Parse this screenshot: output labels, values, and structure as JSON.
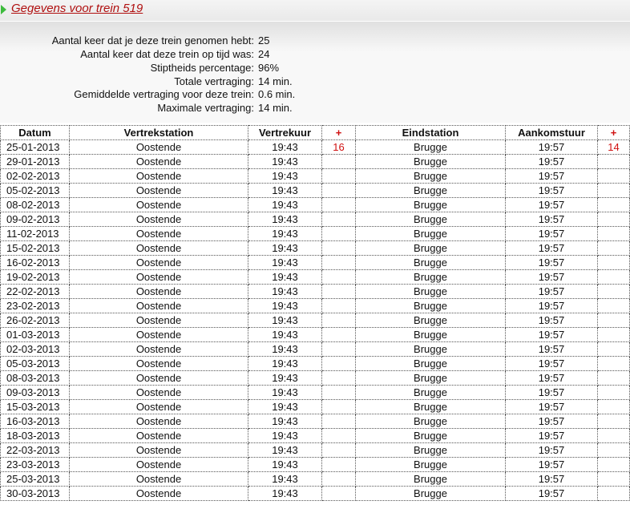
{
  "header": {
    "title": "Gegevens voor trein 519"
  },
  "summary": [
    {
      "label": "Aantal keer dat je deze trein genomen hebt:",
      "value": "25"
    },
    {
      "label": "Aantal keer dat deze trein op tijd was:",
      "value": "24"
    },
    {
      "label": "Stiptheids percentage:",
      "value": "96%"
    },
    {
      "label": "Totale vertraging:",
      "value": "14 min."
    },
    {
      "label": "Gemiddelde vertraging voor deze trein:",
      "value": "0.6 min."
    },
    {
      "label": "Maximale vertraging:",
      "value": "14 min."
    }
  ],
  "table": {
    "columns": [
      "Datum",
      "Vertrekstation",
      "Vertrekuur",
      "+",
      "Eindstation",
      "Aankomstuur",
      "+"
    ],
    "rows": [
      {
        "date": "25-01-2013",
        "from": "Oostende",
        "dep": "19:43",
        "dep_delay": "16",
        "to": "Brugge",
        "arr": "19:57",
        "arr_delay": "14"
      },
      {
        "date": "29-01-2013",
        "from": "Oostende",
        "dep": "19:43",
        "dep_delay": "",
        "to": "Brugge",
        "arr": "19:57",
        "arr_delay": ""
      },
      {
        "date": "02-02-2013",
        "from": "Oostende",
        "dep": "19:43",
        "dep_delay": "",
        "to": "Brugge",
        "arr": "19:57",
        "arr_delay": ""
      },
      {
        "date": "05-02-2013",
        "from": "Oostende",
        "dep": "19:43",
        "dep_delay": "",
        "to": "Brugge",
        "arr": "19:57",
        "arr_delay": ""
      },
      {
        "date": "08-02-2013",
        "from": "Oostende",
        "dep": "19:43",
        "dep_delay": "",
        "to": "Brugge",
        "arr": "19:57",
        "arr_delay": ""
      },
      {
        "date": "09-02-2013",
        "from": "Oostende",
        "dep": "19:43",
        "dep_delay": "",
        "to": "Brugge",
        "arr": "19:57",
        "arr_delay": ""
      },
      {
        "date": "11-02-2013",
        "from": "Oostende",
        "dep": "19:43",
        "dep_delay": "",
        "to": "Brugge",
        "arr": "19:57",
        "arr_delay": ""
      },
      {
        "date": "15-02-2013",
        "from": "Oostende",
        "dep": "19:43",
        "dep_delay": "",
        "to": "Brugge",
        "arr": "19:57",
        "arr_delay": ""
      },
      {
        "date": "16-02-2013",
        "from": "Oostende",
        "dep": "19:43",
        "dep_delay": "",
        "to": "Brugge",
        "arr": "19:57",
        "arr_delay": ""
      },
      {
        "date": "19-02-2013",
        "from": "Oostende",
        "dep": "19:43",
        "dep_delay": "",
        "to": "Brugge",
        "arr": "19:57",
        "arr_delay": ""
      },
      {
        "date": "22-02-2013",
        "from": "Oostende",
        "dep": "19:43",
        "dep_delay": "",
        "to": "Brugge",
        "arr": "19:57",
        "arr_delay": ""
      },
      {
        "date": "23-02-2013",
        "from": "Oostende",
        "dep": "19:43",
        "dep_delay": "",
        "to": "Brugge",
        "arr": "19:57",
        "arr_delay": ""
      },
      {
        "date": "26-02-2013",
        "from": "Oostende",
        "dep": "19:43",
        "dep_delay": "",
        "to": "Brugge",
        "arr": "19:57",
        "arr_delay": ""
      },
      {
        "date": "01-03-2013",
        "from": "Oostende",
        "dep": "19:43",
        "dep_delay": "",
        "to": "Brugge",
        "arr": "19:57",
        "arr_delay": ""
      },
      {
        "date": "02-03-2013",
        "from": "Oostende",
        "dep": "19:43",
        "dep_delay": "",
        "to": "Brugge",
        "arr": "19:57",
        "arr_delay": ""
      },
      {
        "date": "05-03-2013",
        "from": "Oostende",
        "dep": "19:43",
        "dep_delay": "",
        "to": "Brugge",
        "arr": "19:57",
        "arr_delay": ""
      },
      {
        "date": "08-03-2013",
        "from": "Oostende",
        "dep": "19:43",
        "dep_delay": "",
        "to": "Brugge",
        "arr": "19:57",
        "arr_delay": ""
      },
      {
        "date": "09-03-2013",
        "from": "Oostende",
        "dep": "19:43",
        "dep_delay": "",
        "to": "Brugge",
        "arr": "19:57",
        "arr_delay": ""
      },
      {
        "date": "15-03-2013",
        "from": "Oostende",
        "dep": "19:43",
        "dep_delay": "",
        "to": "Brugge",
        "arr": "19:57",
        "arr_delay": ""
      },
      {
        "date": "16-03-2013",
        "from": "Oostende",
        "dep": "19:43",
        "dep_delay": "",
        "to": "Brugge",
        "arr": "19:57",
        "arr_delay": ""
      },
      {
        "date": "18-03-2013",
        "from": "Oostende",
        "dep": "19:43",
        "dep_delay": "",
        "to": "Brugge",
        "arr": "19:57",
        "arr_delay": ""
      },
      {
        "date": "22-03-2013",
        "from": "Oostende",
        "dep": "19:43",
        "dep_delay": "",
        "to": "Brugge",
        "arr": "19:57",
        "arr_delay": ""
      },
      {
        "date": "23-03-2013",
        "from": "Oostende",
        "dep": "19:43",
        "dep_delay": "",
        "to": "Brugge",
        "arr": "19:57",
        "arr_delay": ""
      },
      {
        "date": "25-03-2013",
        "from": "Oostende",
        "dep": "19:43",
        "dep_delay": "",
        "to": "Brugge",
        "arr": "19:57",
        "arr_delay": ""
      },
      {
        "date": "30-03-2013",
        "from": "Oostende",
        "dep": "19:43",
        "dep_delay": "",
        "to": "Brugge",
        "arr": "19:57",
        "arr_delay": ""
      }
    ]
  },
  "colors": {
    "title": "#b01010",
    "delay": "#d01010",
    "arrow": "#3dbb3d"
  }
}
